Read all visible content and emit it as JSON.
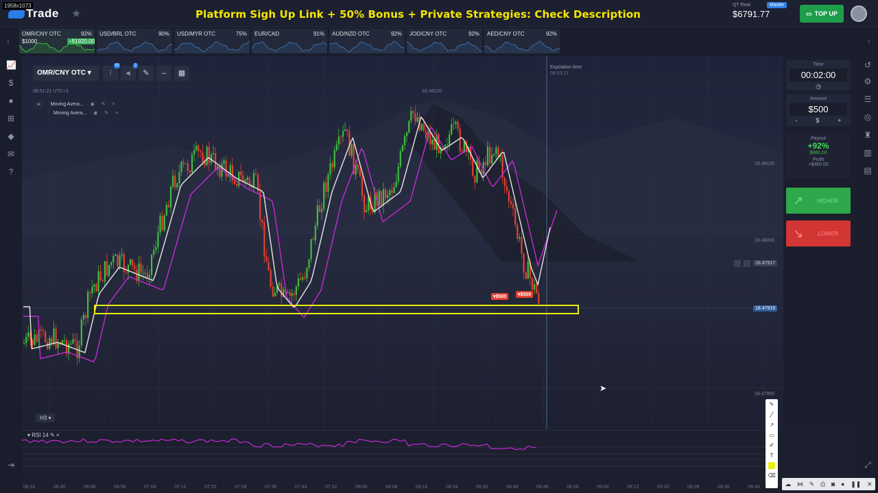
{
  "screen": {
    "dims_label": "1958x1073"
  },
  "app": {
    "logo": "iQ Option",
    "logo_text": "Trade"
  },
  "headline": "Platform Sigh Up Link + 50% Bonus + Private Strategies: Check Description",
  "account": {
    "type": "QT Real",
    "badge": "Master",
    "balance": "$6791.77",
    "topup_label": "TOP UP"
  },
  "asset_tabs": [
    {
      "name": "OMR/CNY OTC",
      "payout": "92%",
      "amount": "$1000",
      "profit": "+$1920.00",
      "active": true
    },
    {
      "name": "USD/BRL OTC",
      "payout": "90%"
    },
    {
      "name": "USD/MYR OTC",
      "payout": "75%"
    },
    {
      "name": "EUR/CAD",
      "payout": "91%"
    },
    {
      "name": "AUD/NZD OTC",
      "payout": "92%"
    },
    {
      "name": "JOD/CNY OTC",
      "payout": "92%"
    },
    {
      "name": "AED/CNY OTC",
      "payout": "92%"
    }
  ],
  "chart": {
    "pair": "OMR/CNY OTC",
    "clock": "08:51:21 UTC+3",
    "indicators": [
      "Moving Avera...",
      "Moving Avera..."
    ],
    "timeframe": "H3",
    "expiration_label": "Expiration time",
    "expiration_time": "08:53:21",
    "top_price": "18.48100",
    "price_ticks": [
      "18.48100",
      "18.48000",
      "18.47900"
    ],
    "current_price": "18.47919",
    "hover_price": "18.47917",
    "trades": [
      {
        "label": "$500"
      },
      {
        "label": "$500"
      }
    ],
    "x_ticks": [
      "06:32",
      "06:40",
      "06:48",
      "06:56",
      "07:04",
      "07:12",
      "07:20",
      "07:28",
      "07:36",
      "07:44",
      "07:52",
      "08:00",
      "08:08",
      "08:16",
      "08:24",
      "08:32",
      "08:40",
      "08:48",
      "08:56",
      "09:04",
      "09:12",
      "09:20",
      "09:28",
      "09:36",
      "09:44"
    ],
    "colors": {
      "up": "#3fbf3f",
      "down": "#e8402e",
      "ma_fast": "#e8e8e8",
      "ma_slow": "#c42ad6",
      "zone": "#e8ee10"
    }
  },
  "rsi": {
    "label": "RSI 14",
    "color": "#c42ad6"
  },
  "trade_panel": {
    "time_label": "Time",
    "time_value": "00:02:00",
    "amount_label": "Amount",
    "amount_value": "$500",
    "amount_minus": "-",
    "amount_currency": "$",
    "amount_plus": "+",
    "payout_label": "Payout",
    "payout_pct": "+92%",
    "payout_value": "$960.00",
    "profit_label": "Profit",
    "profit_value": "+$460.00",
    "higher_label": "HIGHER",
    "lower_label": "LOWER"
  }
}
